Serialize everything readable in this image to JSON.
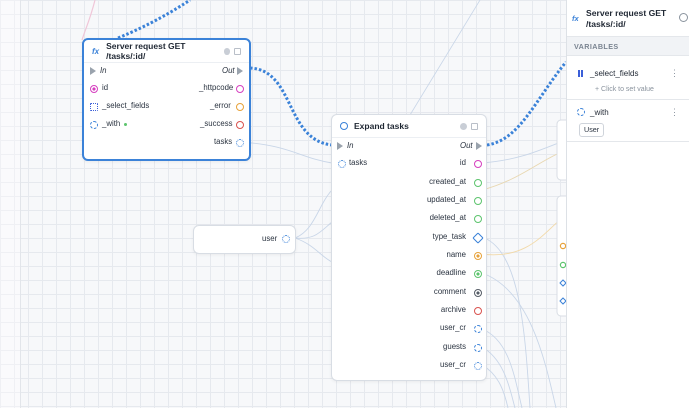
{
  "node_server": {
    "title": "Server request GET /tasks/:id/",
    "fx": "fx",
    "in_label": "In",
    "out_label": "Out",
    "left_ports": [
      "id",
      "_select_fields",
      "_with"
    ],
    "right_ports": [
      "_httpcode",
      "_error",
      "_success",
      "tasks"
    ]
  },
  "node_expand": {
    "title": "Expand tasks",
    "in_label": "In",
    "out_label": "Out",
    "input_port": "tasks",
    "outputs": [
      "id",
      "created_at",
      "updated_at",
      "deleted_at",
      "type_task",
      "name",
      "deadline",
      "comment",
      "archive",
      "user_cr",
      "guests",
      "user_cr"
    ]
  },
  "node_user": {
    "label": "user"
  },
  "panel": {
    "fx": "fx",
    "title": "Server request GET /tasks/:id/",
    "section": "VARIABLES",
    "var1": {
      "name": "_select_fields",
      "hint": "+ Click to set value"
    },
    "var2": {
      "name": "_with",
      "value": "User"
    },
    "kebab": "⋮"
  },
  "colors": {
    "accent": "#3b82d8",
    "port_pink": "#d63fbf",
    "port_orange": "#e7a23a",
    "port_red": "#d9534f",
    "port_green": "#5cc46d",
    "port_blue": "#3b82d8",
    "port_dark": "#555c66"
  }
}
